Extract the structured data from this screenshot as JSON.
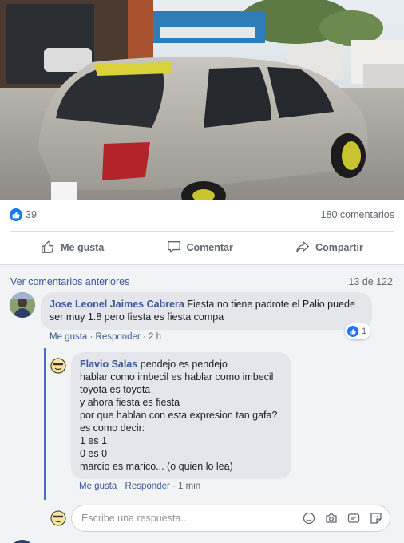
{
  "post": {
    "photo_alt": "",
    "reactions_count": "39",
    "comments_count": "180 comentarios"
  },
  "actions": {
    "like": "Me gusta",
    "comment": "Comentar",
    "share": "Compartir"
  },
  "comments_section": {
    "view_previous": "Ver comentarios anteriores",
    "page_count": "13 de 122",
    "comment": {
      "author": "Jose Leonel Jaimes Cabrera",
      "text": "Fiesta no tiene padrote el Palio puede ser muy 1.8 pero fiesta es fiesta compa",
      "like_label": "Me gusta",
      "reply_label": "Responder",
      "time": "2 h",
      "reaction_count": "1"
    },
    "reply": {
      "author": "Flavio Salas",
      "lines": [
        "pendejo es pendejo",
        "hablar como imbecil es hablar como imbecil",
        "toyota es toyota",
        "y ahora fiesta es fiesta",
        "por que hablan con esta expresion tan gafa?",
        "es como decir:",
        "1 es 1",
        "0 es 0",
        "marcio es marico... (o quien lo lea)"
      ],
      "like_label": "Me gusta",
      "reply_label": "Responder",
      "time": "1 min"
    },
    "reply_input": {
      "placeholder": "Escribe una respuesta..."
    }
  },
  "colors": {
    "link": "#385898",
    "like_blue": "#1877f2",
    "bubble": "#e4e6eb",
    "thread_line": "#4b6ab8"
  },
  "icons": [
    "like-icon",
    "thumb-up-icon",
    "comment-icon",
    "share-icon",
    "emoji-icon",
    "camera-icon",
    "gif-icon",
    "sticker-icon"
  ]
}
